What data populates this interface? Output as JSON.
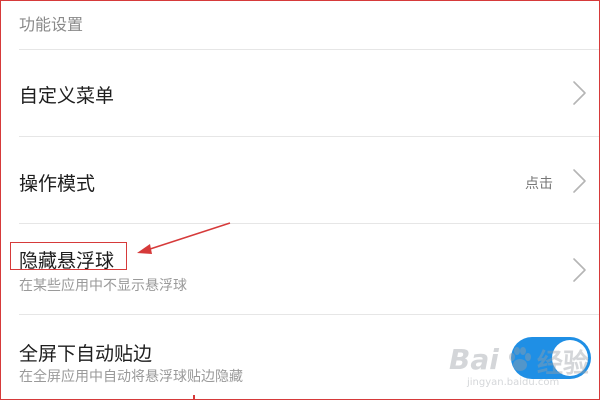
{
  "section": {
    "title": "功能设置"
  },
  "rows": [
    {
      "title": "自定义菜单",
      "subtitle": "",
      "value": ""
    },
    {
      "title": "操作模式",
      "subtitle": "",
      "value": "点击"
    },
    {
      "title": "隐藏悬浮球",
      "subtitle": "在某些应用中不显示悬浮球",
      "value": ""
    },
    {
      "title": "全屏下自动贴边",
      "subtitle": "在全屏应用中自动将悬浮球贴边隐藏",
      "value": ""
    }
  ],
  "toggle": {
    "on": true,
    "color": "#1f8fe5"
  },
  "watermark": {
    "brand": "Bai",
    "suffix": "经验",
    "url": "jingyan.baidu.com"
  },
  "colors": {
    "annotation": "#d63a3a",
    "divider": "#e6e6e6",
    "title": "#1e1e1e",
    "subtitle": "#9a9a9a"
  }
}
